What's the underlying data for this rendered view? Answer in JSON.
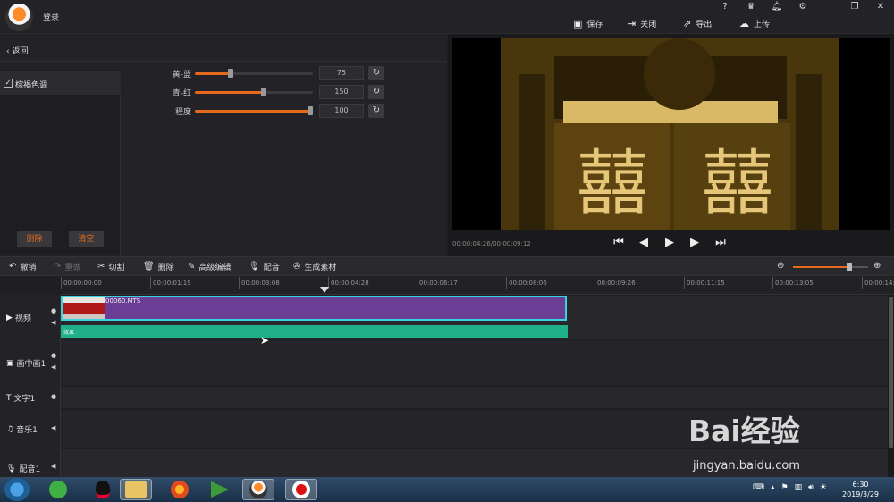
{
  "app": {
    "login_label": "登录"
  },
  "window_controls": {
    "help": "?",
    "vip": "VIP",
    "bell": "bell",
    "gear": "gear",
    "restore": "restore",
    "close": "close"
  },
  "actions": [
    {
      "label": "保存",
      "icon": "save-icon"
    },
    {
      "label": "关闭",
      "icon": "exit-icon"
    },
    {
      "label": "导出",
      "icon": "export-icon"
    },
    {
      "label": "上传",
      "icon": "upload-icon"
    }
  ],
  "effects_panel": {
    "back_label": "返回",
    "effect_item": {
      "label": "棕褐色调",
      "checked": true
    },
    "delete_label": "删除",
    "clear_label": "清空",
    "sliders": [
      {
        "label": "黄-蓝",
        "value": "75",
        "fraction": 0.3
      },
      {
        "label": "青-红",
        "value": "150",
        "fraction": 0.58
      },
      {
        "label": "程度",
        "value": "100",
        "fraction": 1.0
      }
    ]
  },
  "preview": {
    "timecode": "00:00:04:26/00:00:09:12"
  },
  "toolbar": {
    "undo": "撤销",
    "redo": "重做",
    "cut": "切割",
    "delete": "删除",
    "advanced_edit": "高级编辑",
    "dub": "配音",
    "generate": "生成素材",
    "zoom_fraction": 0.75
  },
  "ruler": {
    "labels": [
      "00:00:00:00",
      "00:00:01:19",
      "00:00:03:08",
      "00:00:04:28",
      "00:00:06:17",
      "00:00:08:06",
      "00:00:09:26",
      "00:00:11:15",
      "00:00:13:05",
      "00:00:14:"
    ]
  },
  "tracks": [
    {
      "name": "视频",
      "icon": "video-track-icon"
    },
    {
      "name": "画中画1",
      "icon": "pip-track-icon"
    },
    {
      "name": "文字1",
      "icon": "text-track-icon"
    },
    {
      "name": "音乐1",
      "icon": "music-track-icon"
    },
    {
      "name": "配音1",
      "icon": "mic-track-icon"
    }
  ],
  "timeline": {
    "clip_name": "00060.MTS",
    "effect_clip_name": "效果"
  },
  "taskbar": {
    "time": "6:30",
    "date": "2019/3/29"
  },
  "watermark": {
    "brand": "Bai经验",
    "url": "jingyan.baidu.com"
  }
}
